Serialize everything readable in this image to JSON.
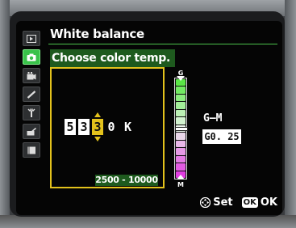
{
  "header": {
    "title": "White balance",
    "subtitle": "Choose color temp."
  },
  "sidebar": {
    "items": [
      {
        "icon": "playback-icon",
        "active": false
      },
      {
        "icon": "camera-icon",
        "active": true
      },
      {
        "icon": "movie-icon",
        "active": false
      },
      {
        "icon": "pencil-icon",
        "active": false
      },
      {
        "icon": "wrench-icon",
        "active": false
      },
      {
        "icon": "retouch-icon",
        "active": false
      },
      {
        "icon": "my-menu-icon",
        "active": false
      }
    ]
  },
  "temperature": {
    "digits": [
      "5",
      "3",
      "3",
      "0"
    ],
    "selected_digit_index": 2,
    "unit": "K",
    "range": "2500 - 10000"
  },
  "tint": {
    "top_label": "G",
    "bottom_label": "M",
    "label": "G–M",
    "value": "G0. 25",
    "marker_position": 0.5
  },
  "footer": {
    "set_label": "Set",
    "ok_badge": "OK",
    "ok_label": "OK"
  },
  "colors": {
    "accent_green": "#39c24a",
    "highlight_yellow": "#e3c21c",
    "panel_green": "#1e5a1e"
  }
}
